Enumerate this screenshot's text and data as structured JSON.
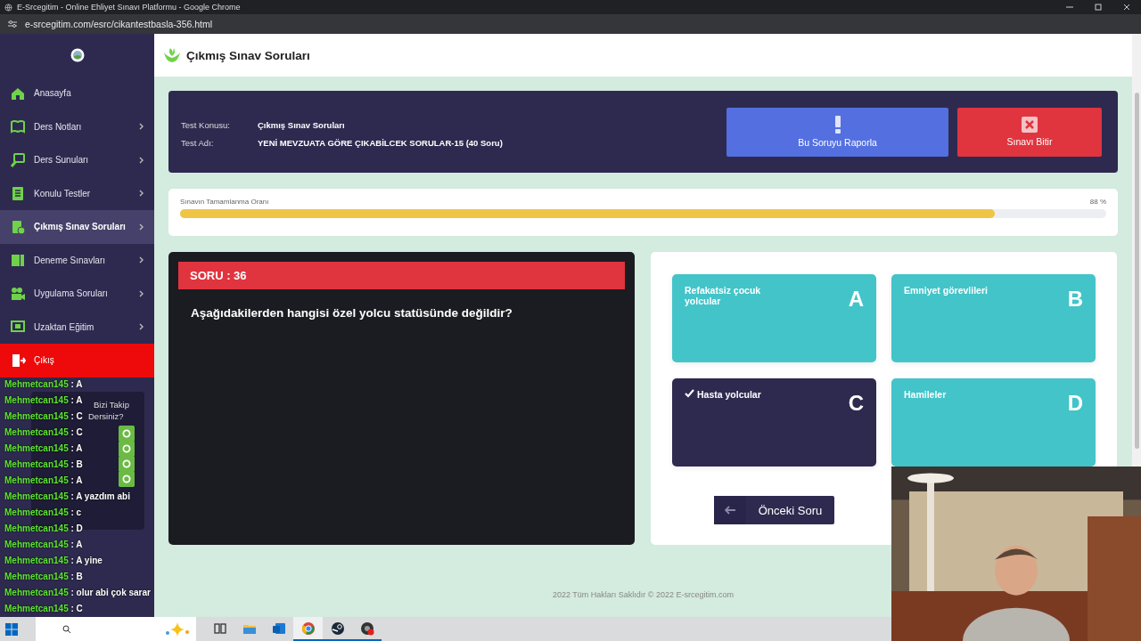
{
  "browser": {
    "title": "E-Srcegitim - Online Ehliyet Sınavı Platformu - Google Chrome",
    "url": "e-srcegitim.com/esrc/cikantestbasla-356.html"
  },
  "sidebar": {
    "items": [
      {
        "label": "Anasayfa",
        "kind": "link",
        "has_submenu": false,
        "selected": false
      },
      {
        "label": "Ders Notları",
        "kind": "link",
        "has_submenu": true,
        "selected": false
      },
      {
        "label": "Ders Sunuları",
        "kind": "link",
        "has_submenu": true,
        "selected": false
      },
      {
        "label": "Konulu Testler",
        "kind": "link",
        "has_submenu": true,
        "selected": false
      },
      {
        "label": "Çıkmış Sınav Soruları",
        "kind": "link",
        "has_submenu": true,
        "selected": true
      },
      {
        "label": "Deneme Sınavları",
        "kind": "link",
        "has_submenu": true,
        "selected": false
      },
      {
        "label": "Uygulama Soruları",
        "kind": "link",
        "has_submenu": true,
        "selected": false
      },
      {
        "label": "Uzaktan Eğitim",
        "kind": "link",
        "has_submenu": true,
        "selected": false
      },
      {
        "label": "Çıkış",
        "kind": "logout",
        "has_submenu": false,
        "selected": false
      }
    ]
  },
  "page_title": "Çıkmış Sınav Soruları",
  "test_info": {
    "fields": [
      {
        "label": "Test Konusu:",
        "value": "Çıkmış Sınav Soruları"
      },
      {
        "label": "Test Adı:",
        "value": "YENİ MEVZUATA GÖRE ÇIKABİLCEK SORULAR-15 (40 Soru)"
      }
    ],
    "buttons": [
      {
        "label": "Bu Soruyu Raporla",
        "kind": "report"
      },
      {
        "label": "Sınavı Bitir",
        "kind": "finish"
      }
    ]
  },
  "progress": {
    "label": "Sınavın Tamamlanma Oranı",
    "reading": "88 %",
    "level": 0.88
  },
  "question": {
    "number": "SORU : 36",
    "text": "Aşağıdakilerden hangisi özel yolcu statüsünde değildir?"
  },
  "options": [
    {
      "letter": "A",
      "text": "Refakatsiz çocuk yolcular",
      "selected": false
    },
    {
      "letter": "B",
      "text": "Emniyet görevlileri",
      "selected": false
    },
    {
      "letter": "C",
      "text": "Hasta yolcular",
      "selected": true
    },
    {
      "letter": "D",
      "text": "Hamileler",
      "selected": false
    }
  ],
  "prev_button": "Önceki Soru",
  "footer": "2022 Tüm Hakları Saklıdır © 2022 E-srcegitim.com",
  "follow_popup": {
    "lines": [
      "Bizi Takip",
      "Dersiniz?"
    ]
  },
  "chat": [
    {
      "user": "Mehmetcan145",
      "text": ": A"
    },
    {
      "user": "Mehmetcan145",
      "text": ": A"
    },
    {
      "user": "Mehmetcan145",
      "text": ": C"
    },
    {
      "user": "Mehmetcan145",
      "text": ": C"
    },
    {
      "user": "Mehmetcan145",
      "text": ": A"
    },
    {
      "user": "Mehmetcan145",
      "text": ": B"
    },
    {
      "user": "Mehmetcan145",
      "text": ": A"
    },
    {
      "user": "Mehmetcan145",
      "text": ": A yazdım abi"
    },
    {
      "user": "Mehmetcan145",
      "text": ": c"
    },
    {
      "user": "Mehmetcan145",
      "text": ": D"
    },
    {
      "user": "Mehmetcan145",
      "text": ": A"
    },
    {
      "user": "Mehmetcan145",
      "text": ": A yine"
    },
    {
      "user": "Mehmetcan145",
      "text": ": B"
    },
    {
      "user": "Mehmetcan145",
      "text": ": olur abi çok sarar"
    },
    {
      "user": "Mehmetcan145",
      "text": ": C"
    }
  ],
  "taskbar": {
    "apps": [
      {
        "open": false,
        "active": false
      },
      {
        "open": false,
        "active": false
      },
      {
        "open": false,
        "active": false
      },
      {
        "open": true,
        "active": true
      },
      {
        "open": true,
        "active": false
      },
      {
        "open": true,
        "active": false
      }
    ]
  }
}
